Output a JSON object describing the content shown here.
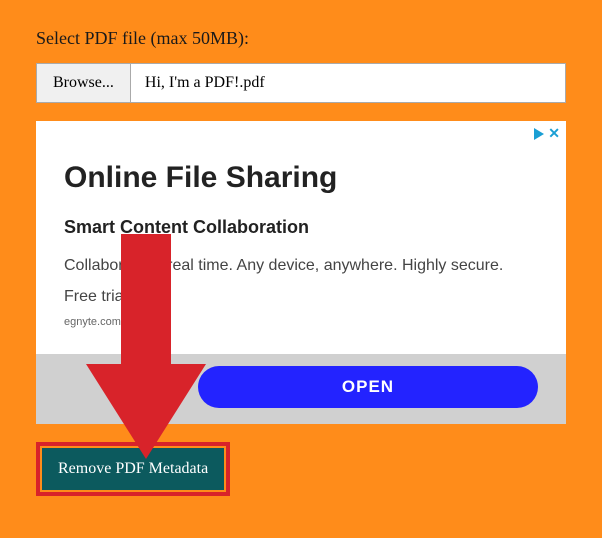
{
  "label": "Select PDF file (max 50MB):",
  "browse": "Browse...",
  "filename": "Hi, I'm a PDF!.pdf",
  "ad": {
    "headline": "Online File Sharing",
    "subhead": "Smart Content Collaboration",
    "body_line1": "Collaborate in real time. Any device, anywhere. Highly secure.",
    "body_line2": "Free trial!",
    "domain": "egnyte.com",
    "cta": "OPEN",
    "close": "✕"
  },
  "action": {
    "remove": "Remove PDF Metadata"
  }
}
